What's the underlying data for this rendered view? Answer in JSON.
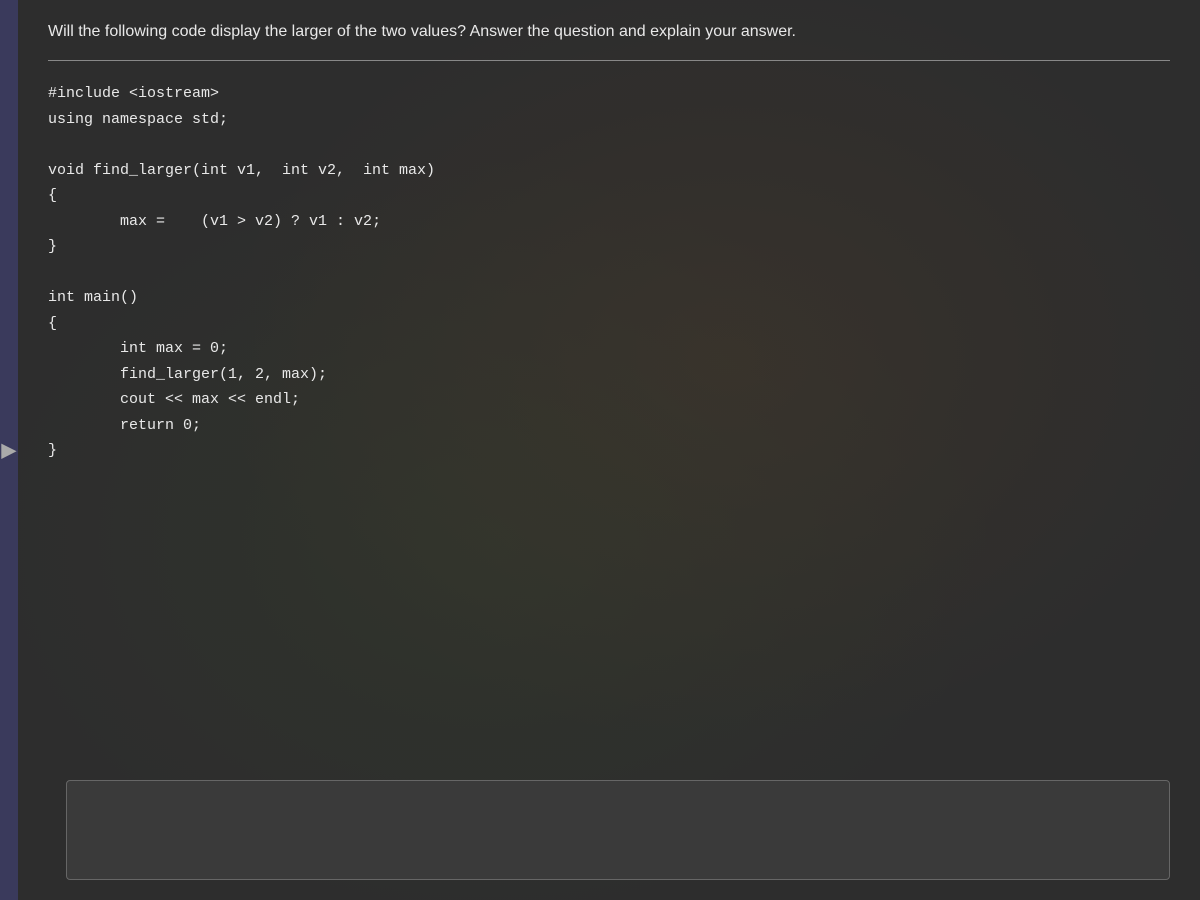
{
  "sidebar": {
    "color": "#3a3a5c"
  },
  "question": {
    "text": "Will the following code display the larger of the two values? Answer the question and explain your answer."
  },
  "code": {
    "line1": "#include <iostream>",
    "line2": "using namespace std;",
    "line3": "",
    "line4": "void find_larger(int v1,  int v2,  int max)",
    "line5": "{",
    "line6": "    max =    (v1 > v2) ? v1 : v2;",
    "line7": "}",
    "line8": "",
    "line9": "int main()",
    "line10": "{",
    "line11": "    int max = 0;",
    "line12": "    find_larger(1, 2, max);",
    "line13": "    cout << max << endl;",
    "line14": "    return 0;",
    "line15": "}"
  },
  "nav": {
    "arrow": "▶"
  }
}
